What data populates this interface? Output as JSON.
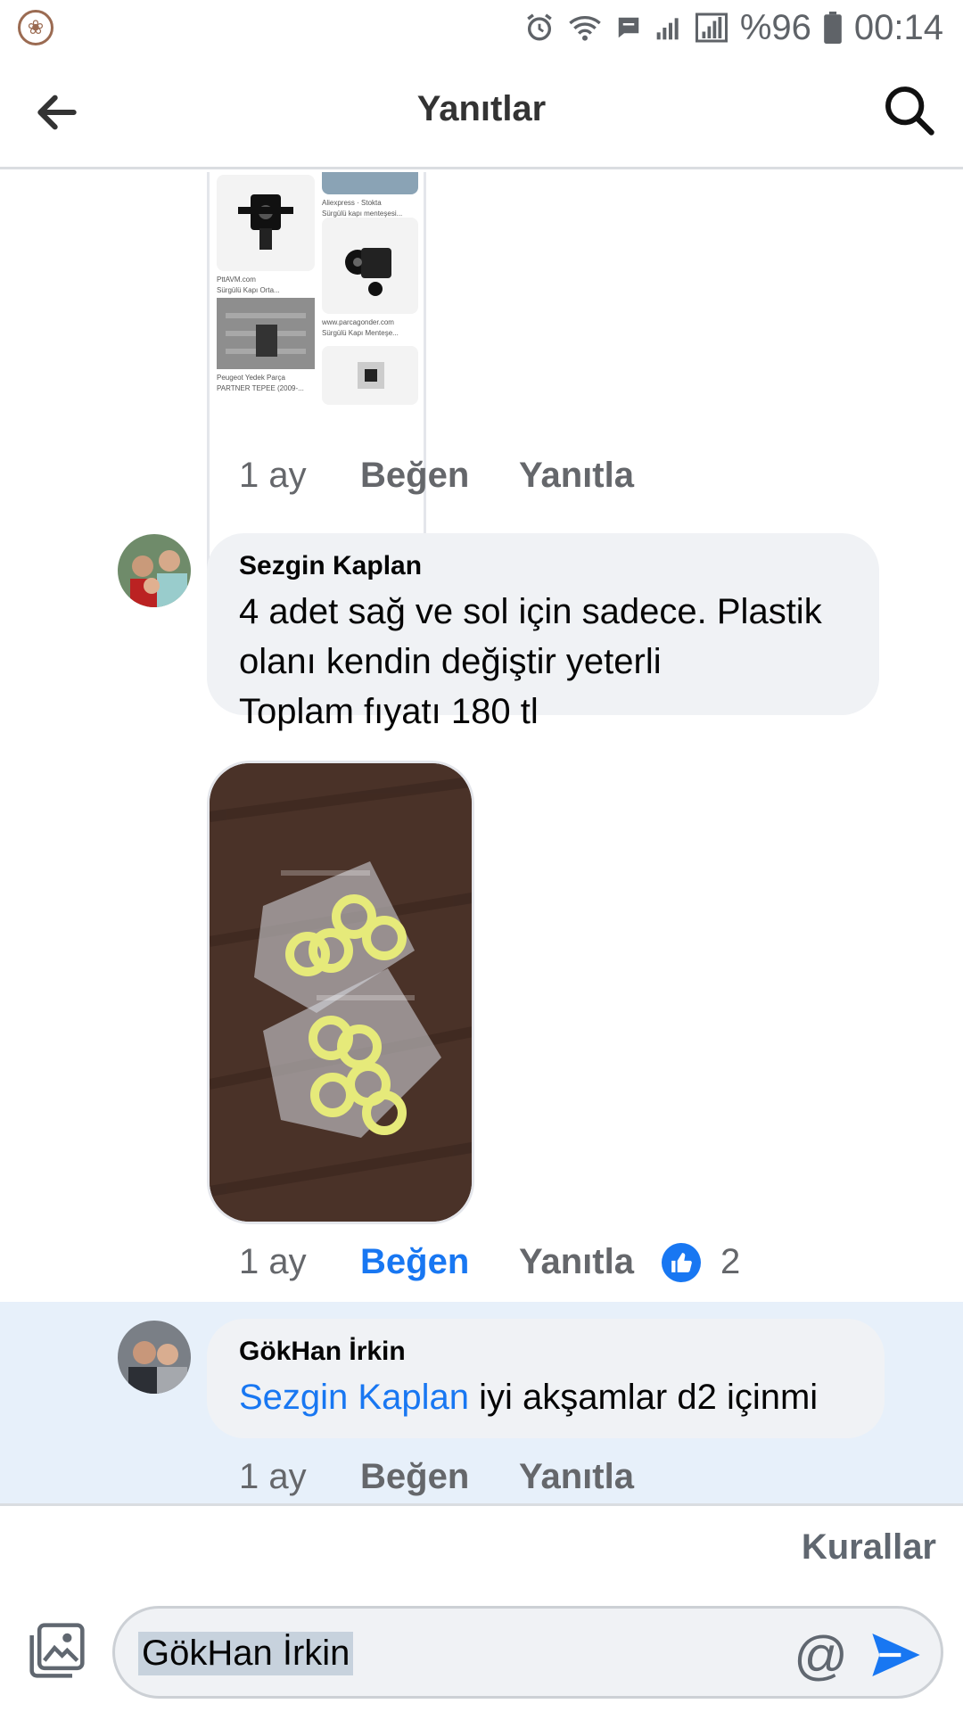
{
  "status_bar": {
    "battery": "%96",
    "time": "00:14"
  },
  "header": {
    "title": "Yanıtlar"
  },
  "comments": [
    {
      "time": "1 ay",
      "like_label": "Beğen",
      "reply_label": "Yanıtla"
    },
    {
      "author": "Sezgin Kaplan",
      "text": "4 adet sağ ve sol için sadece. Plastik\nolanı kendin değiştir yeterli\n Toplam fıyatı 180 tl",
      "time": "1 ay",
      "like_label": "Beğen",
      "reply_label": "Yanıtla",
      "reaction_count": "2"
    },
    {
      "author": "GökHan İrkin",
      "mention": "Sezgin Kaplan",
      "text": " iyi akşamlar d2 içinmi",
      "time": "1 ay",
      "like_label": "Beğen",
      "reply_label": "Yanıtla"
    }
  ],
  "thumbnail": {
    "captions": [
      "Aliexpress · Stokta",
      "Sürgülü kapı menteşesi...",
      "PttAVM.com",
      "Sürgülü Kapı Orta...",
      "www.parcagonder.com",
      "Sürgülü Kapı Menteşe...",
      "Peugeot Yedek Parça",
      "PARTNER TEPEE (2009-..."
    ]
  },
  "composer": {
    "rules_label": "Kurallar",
    "input_value": "GökHan İrkin"
  },
  "colors": {
    "accent": "#1877f2",
    "bubble": "#f0f2f5",
    "highlight": "#e7f0fa"
  }
}
